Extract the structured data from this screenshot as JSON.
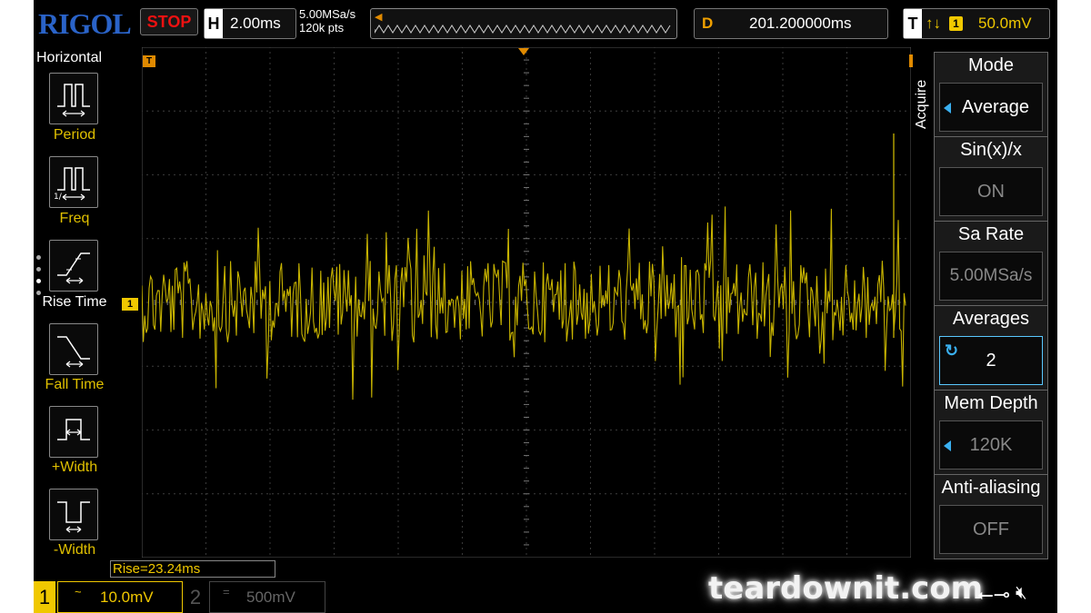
{
  "header": {
    "brand": "RIGOL",
    "run_state": "STOP",
    "horizontal": {
      "label": "H",
      "scale": "2.00ms"
    },
    "sample_rate": "5.00MSa/s",
    "memory_points": "120k pts",
    "delay": {
      "label": "D",
      "value": "201.200000ms"
    },
    "trigger": {
      "label": "T",
      "edge": "↑↓",
      "source": "1",
      "level": "50.0mV"
    }
  },
  "left_menu": {
    "title": "Horizontal",
    "items": [
      {
        "label": "Period",
        "icon": "period-icon",
        "selected": false
      },
      {
        "label": "Freq",
        "icon": "freq-icon",
        "selected": false
      },
      {
        "label": "Rise Time",
        "icon": "rise-time-icon",
        "selected": true
      },
      {
        "label": "Fall Time",
        "icon": "fall-time-icon",
        "selected": false
      },
      {
        "label": "+Width",
        "icon": "pos-width-icon",
        "selected": false
      },
      {
        "label": "-Width",
        "icon": "neg-width-icon",
        "selected": false
      }
    ]
  },
  "markers": {
    "ch1": "1",
    "trigger": "T"
  },
  "right_menu": {
    "section": "Acquire",
    "groups": [
      {
        "title": "Mode",
        "value": "Average",
        "state": "bright",
        "arrow": true
      },
      {
        "title": "Sin(x)/x",
        "value": "ON",
        "state": "dim"
      },
      {
        "title": "Sa Rate",
        "value": "5.00MSa/s",
        "state": "dim"
      },
      {
        "title": "Averages",
        "value": "2",
        "state": "active",
        "knob": true
      },
      {
        "title": "Mem Depth",
        "value": "120K",
        "state": "dim",
        "arrow": true
      },
      {
        "title": "Anti-aliasing",
        "value": "OFF",
        "state": "dim"
      }
    ]
  },
  "footer": {
    "measurement": "Rise=23.24ms",
    "ch1": {
      "number": "1",
      "coupling": "~",
      "scale": "10.0mV"
    },
    "ch2": {
      "number": "2",
      "coupling": "=",
      "scale": "500mV"
    },
    "watermark": "teardownit.com"
  },
  "colors": {
    "ch1": "#f0c800",
    "trace": "#c8b400",
    "trigger": "#e08a00",
    "brand": "#2a63c8",
    "stop": "#ee1111",
    "highlight": "#3ab0f0"
  }
}
